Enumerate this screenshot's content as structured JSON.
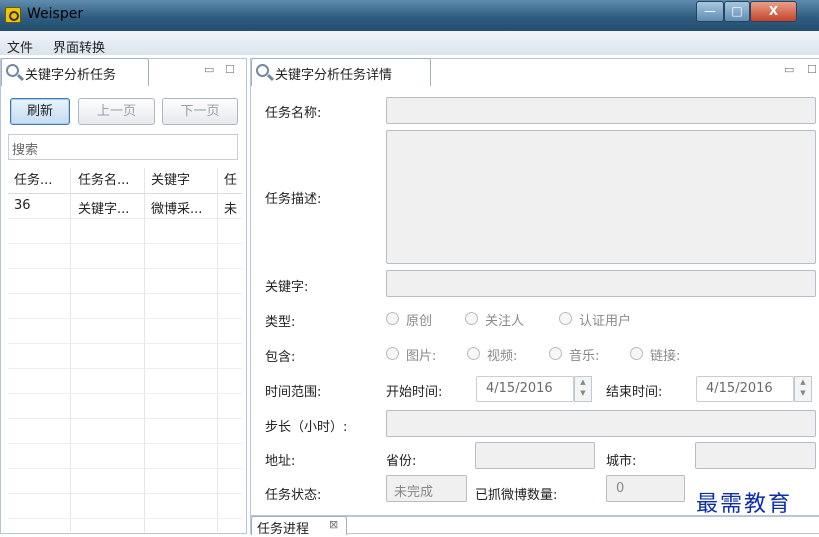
{
  "window": {
    "title": "Weisper",
    "minimize": "—",
    "maximize": "□",
    "close": "X"
  },
  "menu": [
    "文件",
    "界面转换"
  ],
  "left_panel": {
    "tab_label": "关键字分析任务",
    "controls": {
      "minimize": "▭",
      "maximize": "☐"
    },
    "buttons": {
      "refresh": "刷新",
      "prev": "上一页",
      "next": "下一页"
    },
    "search_placeholder": "搜索",
    "columns": [
      "任务...",
      "任务名...",
      "关键字",
      "任"
    ],
    "rows": [
      [
        "36",
        "关键字...",
        "微博采...",
        "未"
      ]
    ]
  },
  "right_panel": {
    "tab_label": "关键字分析任务详情",
    "controls": {
      "minimize": "▭",
      "maximize": "☐"
    },
    "labels": {
      "task_name": "任务名称:",
      "task_desc": "任务描述:",
      "keyword": "关键字:",
      "type": "类型:",
      "include": "包含:",
      "time_range": "时间范围:",
      "start_time": "开始时间:",
      "end_time": "结束时间:",
      "step": "步长（小时）:",
      "address": "地址:",
      "province": "省份:",
      "city": "城市:",
      "task_status": "任务状态:",
      "crawled_count": "已抓微博数量:"
    },
    "type_options": [
      "原创",
      "关注人",
      "认证用户"
    ],
    "include_options": [
      "图片:",
      "视频:",
      "音乐:",
      "链接:"
    ],
    "start_date": "4/15/2016",
    "end_date": "4/15/2016",
    "status_value": "未完成",
    "count_value": "0"
  },
  "bottom_panel": {
    "tab_label": "任务进程",
    "close": "⊠"
  },
  "watermark": "最需教育",
  "icons": [
    "app-icon",
    "search-tab-icon",
    "radio-icon",
    "spinner-icon"
  ]
}
